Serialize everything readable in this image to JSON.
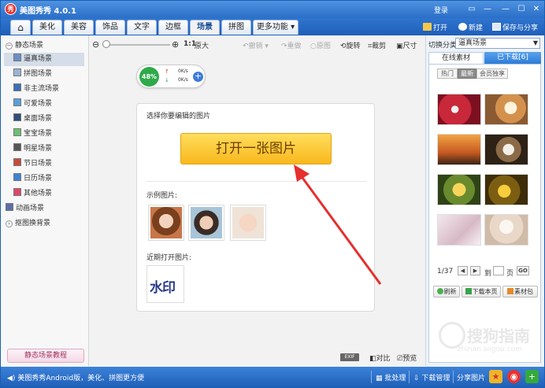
{
  "titlebar": {
    "app_logo_text": "秀",
    "app_title": "美图秀秀 4.0.1",
    "login": "登录"
  },
  "window_controls": [
    "▭",
    "—",
    "☐",
    "✕"
  ],
  "tabs": {
    "home_icon": "⌂",
    "items": [
      "美化",
      "美容",
      "饰品",
      "文字",
      "边框",
      "场景",
      "拼图",
      "更多功能 ▾"
    ],
    "active_index": 5
  },
  "top_actions": {
    "open": "打开",
    "new": "新建",
    "save_share": "保存与分享"
  },
  "left_tree": {
    "static_group": "静态场景",
    "items": [
      "逼真场景",
      "拼图场景",
      "非主流场景",
      "可爱场景",
      "桌面场景",
      "宝宝场景",
      "明星场景",
      "节日场景",
      "日历场景",
      "其他场景"
    ],
    "selected_index": 0,
    "dynamic_group": "动画场景",
    "cutout_group": "抠图换背景",
    "tutorial_button": "静态场景教程"
  },
  "toolbar": {
    "zoom_ratio": "1:1",
    "original": "原大",
    "undo": "撤销",
    "redo": "重做",
    "restore": "原图",
    "rotate": "旋转",
    "crop": "裁剪",
    "size": "尺寸"
  },
  "memory_widget": {
    "percent": "48%",
    "up_speed": "0K/s",
    "down_speed": "0K/s",
    "up_arrow": "↑",
    "down_arrow": "↓",
    "plus": "+"
  },
  "card": {
    "select_prompt": "选择你要编辑的图片",
    "open_button": "打开一张图片",
    "samples_label": "示例图片:",
    "recent_label": "近期打开图片:",
    "recent_item_text": "水印"
  },
  "right_panel": {
    "category_label": "切换分类",
    "category_value": "逼真场景",
    "tab_online": "在线素材",
    "tab_downloaded": "已下载[6]",
    "filters": [
      "热门",
      "最新",
      "会员独享"
    ],
    "active_filter": 1,
    "page_info": "1/37",
    "goto_label": "到",
    "page_unit": "页",
    "go_button": "GO",
    "refresh": "刷新",
    "download_page": "下载本页",
    "material_pack": "素材包"
  },
  "bottom_tools": {
    "exif": "EXIF",
    "compare": "对比",
    "preview": "预览"
  },
  "statusbar": {
    "text": "美图秀秀Android版，美化、拼图更方便",
    "batch": "批处理",
    "download_mgr": "下载管理",
    "share_picture": "分享图片"
  },
  "watermark": {
    "main": "搜狗指南",
    "sub": "zhinan.sogou.com"
  },
  "colors": {
    "titlebar": "#2a6fc8",
    "open_button": "#f8b81d",
    "arrow": "#e5302d",
    "active_tab_text": "#1a4f9a"
  }
}
